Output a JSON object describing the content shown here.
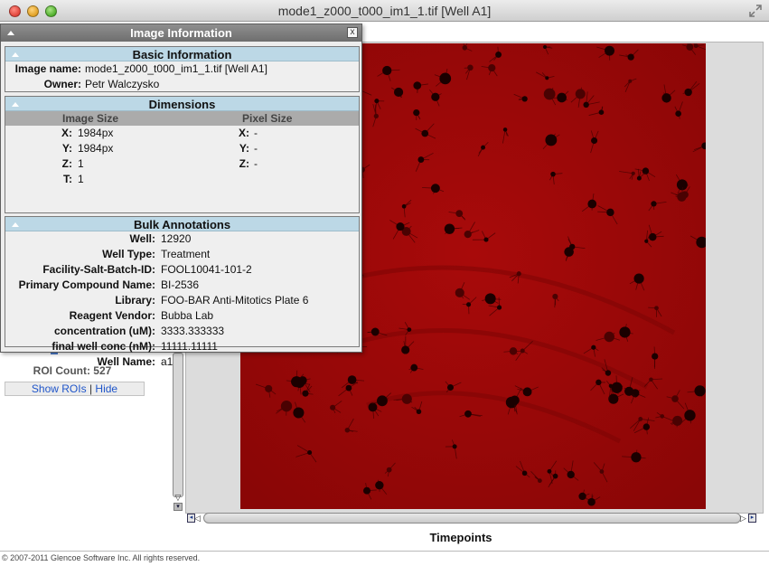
{
  "window": {
    "title": "mode1_z000_t000_im1_1.tif [Well A1]"
  },
  "info_panel": {
    "title": "Image Information",
    "close_glyph": "x",
    "basic": {
      "header": "Basic Information",
      "rows": [
        {
          "label": "Image name:",
          "value": "mode1_z000_t000_im1_1.tif [Well A1]"
        },
        {
          "label": "Owner:",
          "value": "Petr Walczysko"
        }
      ]
    },
    "dimensions": {
      "header": "Dimensions",
      "image_size_header": "Image Size",
      "pixel_size_header": "Pixel Size",
      "image_size": [
        {
          "label": "X:",
          "value": "1984px"
        },
        {
          "label": "Y:",
          "value": "1984px"
        },
        {
          "label": "Z:",
          "value": "1"
        },
        {
          "label": "T:",
          "value": "1"
        }
      ],
      "pixel_size": [
        {
          "label": "X:",
          "value": "-"
        },
        {
          "label": "Y:",
          "value": "-"
        },
        {
          "label": "Z:",
          "value": "-"
        }
      ]
    },
    "bulk": {
      "header": "Bulk Annotations",
      "rows": [
        {
          "label": "Well:",
          "value": "12920"
        },
        {
          "label": "Well Type:",
          "value": "Treatment"
        },
        {
          "label": "Facility-Salt-Batch-ID:",
          "value": "FOOL10041-101-2"
        },
        {
          "label": "Primary Compound Name:",
          "value": "BI-2536"
        },
        {
          "label": "Library:",
          "value": "FOO-BAR Anti-Mitotics Plate 6"
        },
        {
          "label": "Reagent Vendor:",
          "value": "Bubba Lab"
        },
        {
          "label": "concentration (uM):",
          "value": "3333.333333"
        },
        {
          "label": "final well conc (nM):",
          "value": "11111.11111"
        },
        {
          "label": "Well Name:",
          "value": "a1"
        }
      ]
    }
  },
  "roi": {
    "count_text": "ROI Count: 527",
    "show_label": "Show ROIs",
    "separator": "|",
    "hide_label": "Hide"
  },
  "viewer": {
    "time_label": "Timepoints",
    "image_color": "#9a0808"
  },
  "footer": {
    "text": "© 2007-2011 Glencoe Software Inc. All rights reserved."
  },
  "colors": {
    "section_header": "#bcd8e6",
    "panel_header": "#7a7a7a",
    "link": "#1f55c9"
  }
}
